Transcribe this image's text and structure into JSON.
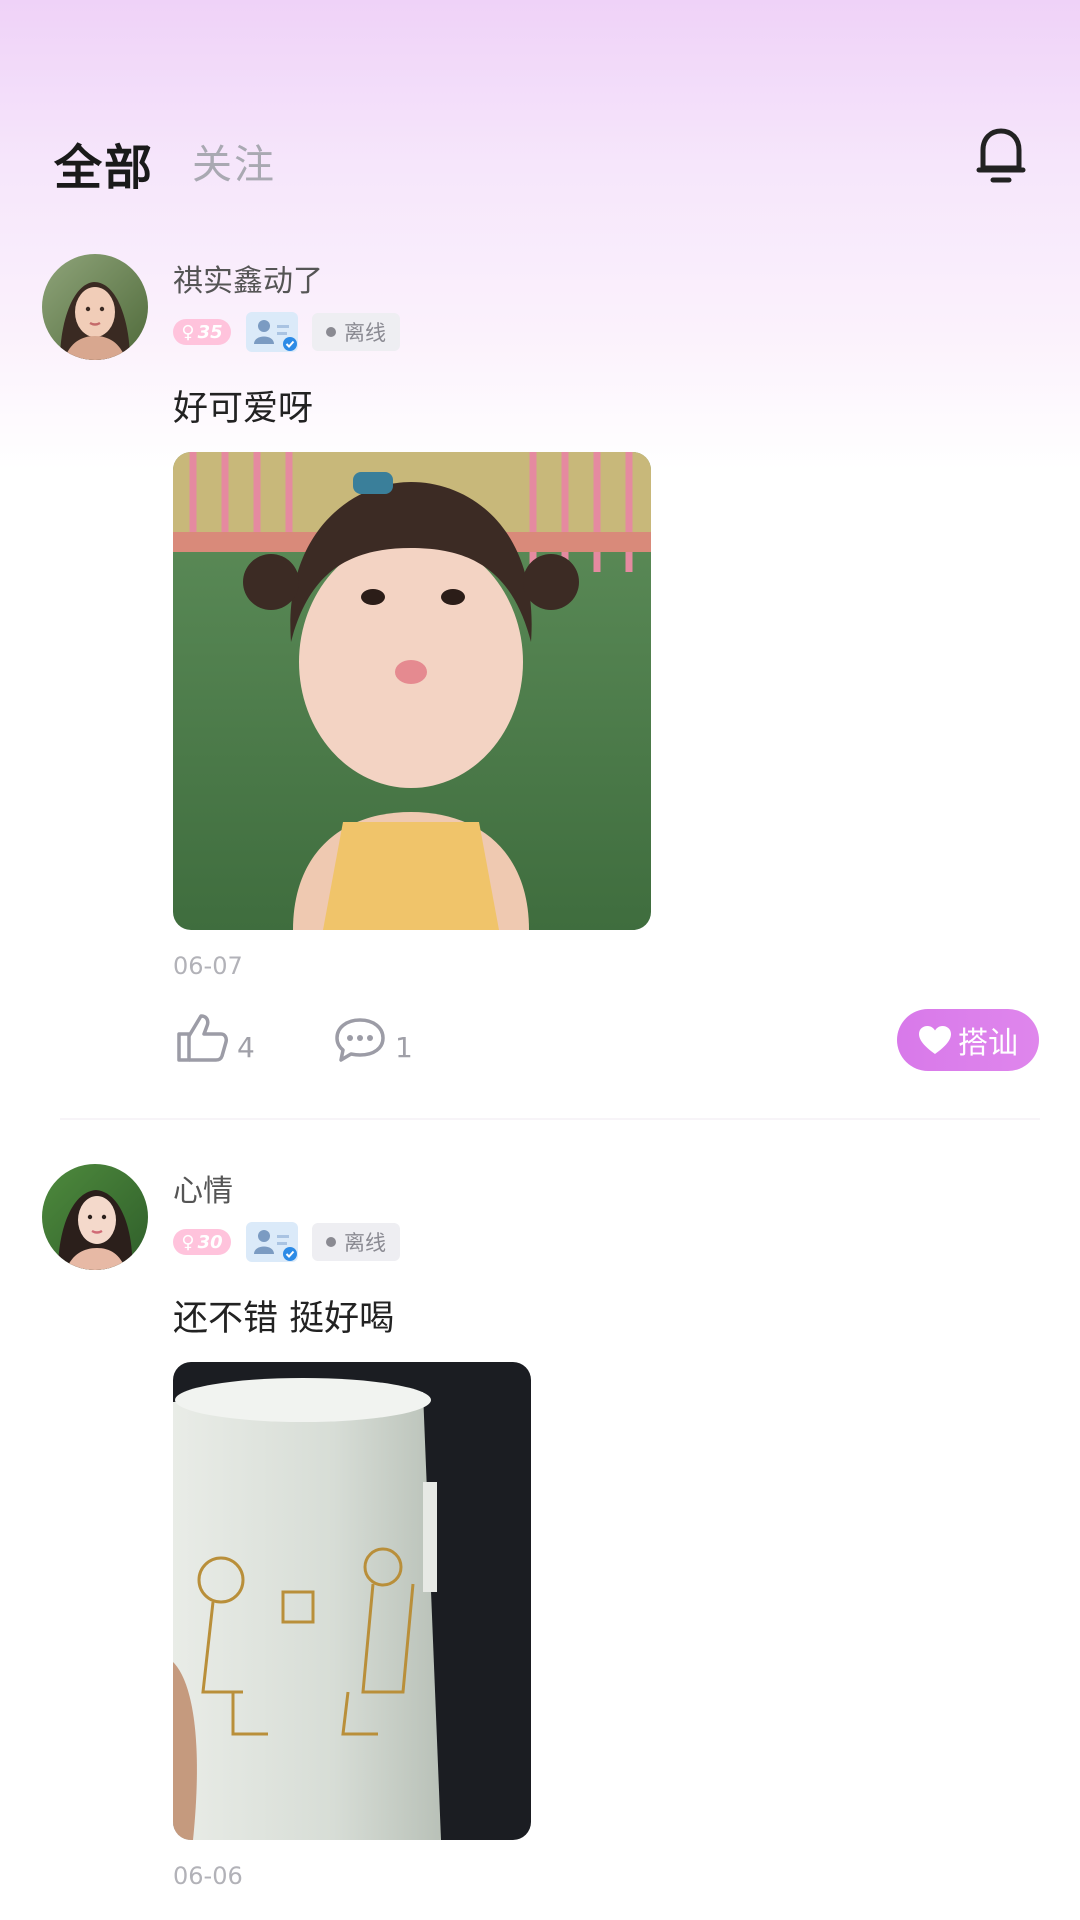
{
  "header": {
    "tabs": [
      {
        "label": "全部",
        "active": true
      },
      {
        "label": "关注",
        "active": false
      }
    ],
    "bell_icon": "bell-icon"
  },
  "colors": {
    "accent": "#db7de9",
    "age_badge": "#ffc3dc",
    "status_badge_bg": "#eeeef2"
  },
  "posts": [
    {
      "username": "祺实鑫动了",
      "gender_symbol": "♀",
      "age": "35",
      "status": "离线",
      "text": "好可爱呀",
      "date": "06-07",
      "likes": "4",
      "comments": "1",
      "chat_label": "搭讪"
    },
    {
      "username": "心情",
      "gender_symbol": "♀",
      "age": "30",
      "status": "离线",
      "text": "还不错 挺好喝",
      "date": "06-06"
    }
  ]
}
